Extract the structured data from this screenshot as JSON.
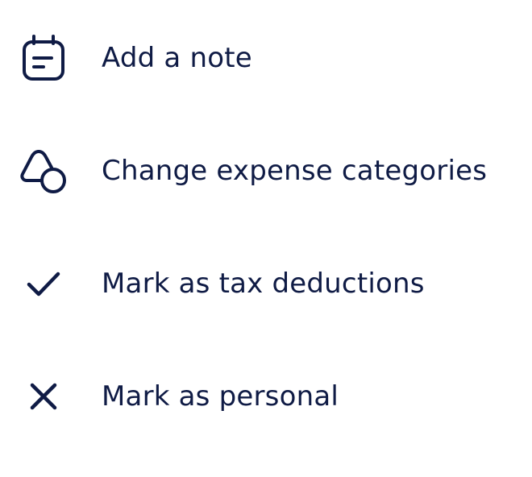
{
  "theme": {
    "text_color": "#0f1b45",
    "icon_color": "#0f1b45",
    "background": "#ffffff"
  },
  "menu": {
    "items": [
      {
        "label": "Add a note",
        "icon": "note-icon"
      },
      {
        "label": "Change expense categories",
        "icon": "shapes-icon"
      },
      {
        "label": "Mark as tax deductions",
        "icon": "check-icon"
      },
      {
        "label": "Mark as personal",
        "icon": "close-icon"
      }
    ]
  }
}
